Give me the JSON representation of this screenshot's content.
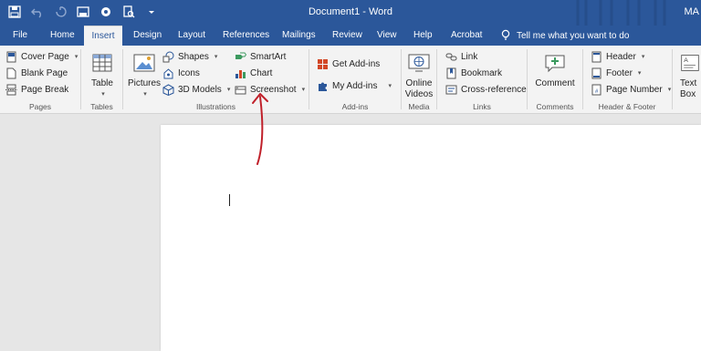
{
  "window": {
    "title": "Document1 - Word",
    "user": "MA"
  },
  "qat": [
    {
      "icon": "save-icon"
    },
    {
      "icon": "undo-icon"
    },
    {
      "icon": "redo-icon"
    },
    {
      "icon": "print-layout-icon"
    },
    {
      "icon": "touch-mode-icon"
    },
    {
      "icon": "print-preview-icon"
    },
    {
      "icon": "customize-qat-icon"
    }
  ],
  "tabs": [
    {
      "label": "File"
    },
    {
      "label": "Home"
    },
    {
      "label": "Insert",
      "active": true
    },
    {
      "label": "Design"
    },
    {
      "label": "Layout"
    },
    {
      "label": "References"
    },
    {
      "label": "Mailings"
    },
    {
      "label": "Review"
    },
    {
      "label": "View"
    },
    {
      "label": "Help"
    },
    {
      "label": "Acrobat"
    }
  ],
  "tell_me": "Tell me what you want to do",
  "ribbon": {
    "pages": {
      "label": "Pages",
      "cover_page": "Cover Page",
      "blank_page": "Blank Page",
      "page_break": "Page Break"
    },
    "tables": {
      "label": "Tables",
      "table": "Table"
    },
    "illustrations": {
      "label": "Illustrations",
      "pictures": "Pictures",
      "shapes": "Shapes",
      "icons": "Icons",
      "models_3d": "3D Models",
      "smartart": "SmartArt",
      "chart": "Chart",
      "screenshot": "Screenshot"
    },
    "addins": {
      "label": "Add-ins",
      "get_addins": "Get Add-ins",
      "my_addins": "My Add-ins"
    },
    "media": {
      "label": "Media",
      "online_videos_1": "Online",
      "online_videos_2": "Videos"
    },
    "links": {
      "label": "Links",
      "link": "Link",
      "bookmark": "Bookmark",
      "cross_reference": "Cross-reference"
    },
    "comments": {
      "label": "Comments",
      "comment": "Comment"
    },
    "header_footer": {
      "label": "Header & Footer",
      "header": "Header",
      "footer": "Footer",
      "page_number": "Page Number"
    },
    "text": {
      "text_box_1": "Text",
      "text_box_2": "Box"
    }
  },
  "colors": {
    "title_bar": "#2b579a",
    "ribbon": "#f3f3f3",
    "annotation": "#c0202a"
  }
}
